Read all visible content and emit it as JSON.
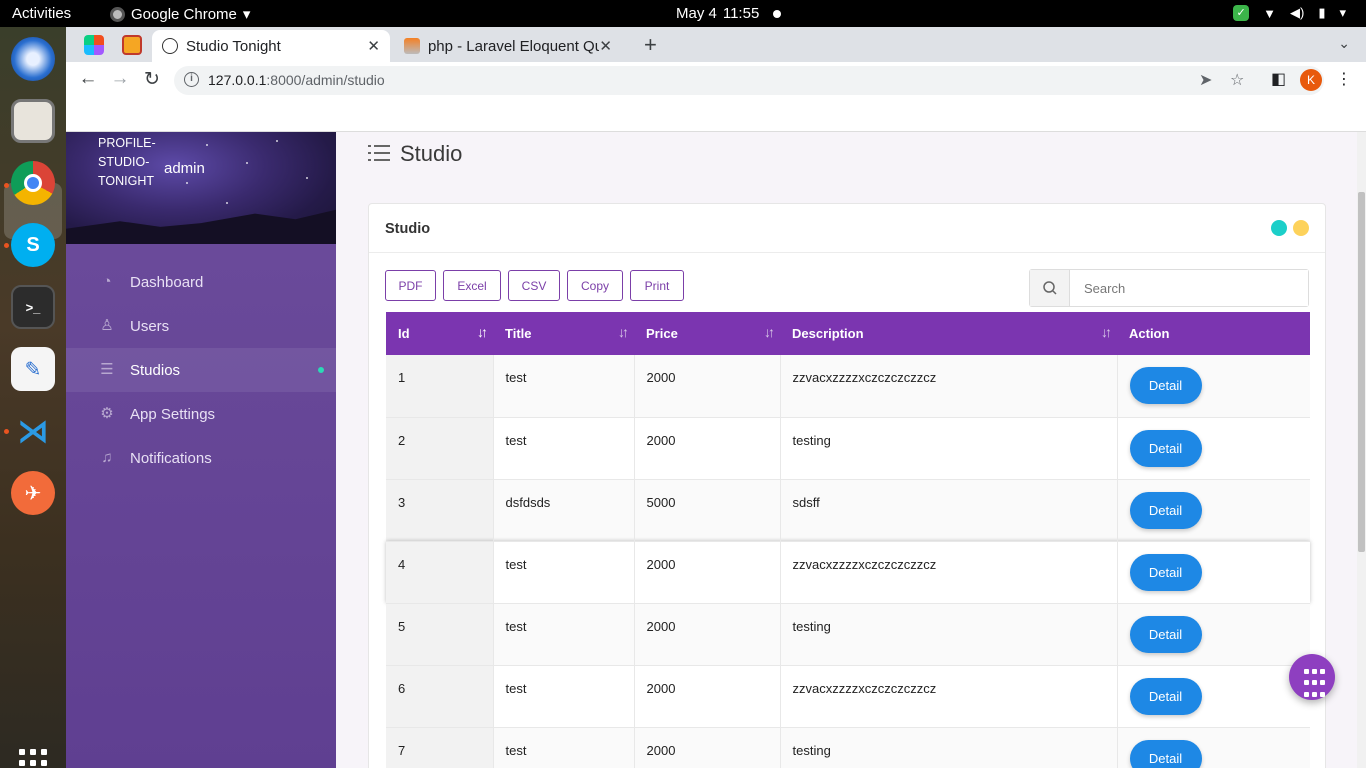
{
  "os": {
    "activities": "Activities",
    "app_name": "Google Chrome",
    "app_menu_arrow": "▾",
    "date": "May 4",
    "time": "11:55"
  },
  "browser": {
    "tabs": [
      {
        "title": "Studio Tonight",
        "active": true
      },
      {
        "title": "php - Laravel Eloquent Qu",
        "active": false
      }
    ],
    "url_host": "127.0.0.1",
    "url_path": ":8000/admin/studio",
    "profile_initial": "K"
  },
  "sidebar": {
    "profile_image_alt": "PROFILE-STUDIO-TONIGHT",
    "username": "admin",
    "items": [
      {
        "label": "Dashboard"
      },
      {
        "label": "Users"
      },
      {
        "label": "Studios"
      },
      {
        "label": "App Settings"
      },
      {
        "label": "Notifications"
      }
    ]
  },
  "page": {
    "title": "Studio"
  },
  "card": {
    "title": "Studio",
    "dot_colors": [
      "#1ccfc9",
      "#fdd25b"
    ],
    "export_buttons": [
      "PDF",
      "Excel",
      "CSV",
      "Copy",
      "Print"
    ],
    "search_placeholder": "Search"
  },
  "table": {
    "columns": [
      "Id",
      "Title",
      "Price",
      "Description",
      "Action"
    ],
    "action_label": "Detail",
    "rows": [
      {
        "id": "1",
        "title": "test",
        "price": "2000",
        "description": "zzvacxzzzzxczczczczzcz"
      },
      {
        "id": "2",
        "title": "test",
        "price": "2000",
        "description": "testing"
      },
      {
        "id": "3",
        "title": "dsfdsds",
        "price": "5000",
        "description": "sdsff"
      },
      {
        "id": "4",
        "title": "test",
        "price": "2000",
        "description": "zzvacxzzzzxczczczczzcz"
      },
      {
        "id": "5",
        "title": "test",
        "price": "2000",
        "description": "testing"
      },
      {
        "id": "6",
        "title": "test",
        "price": "2000",
        "description": "zzvacxzzzzxczczczczzcz"
      },
      {
        "id": "7",
        "title": "test",
        "price": "2000",
        "description": "testing"
      }
    ]
  },
  "colors": {
    "sidebar": "#5f3f91",
    "table_header": "#7b35b0",
    "detail_button": "#1e88e5",
    "fab": "#8e3fc0"
  }
}
